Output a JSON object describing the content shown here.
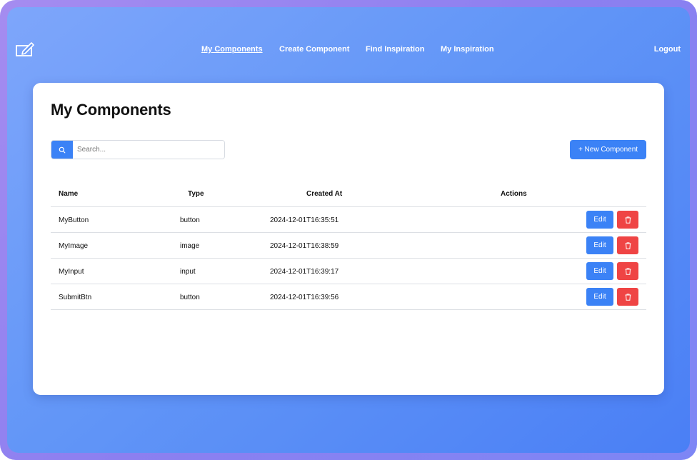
{
  "nav": {
    "links": [
      {
        "label": "My Components",
        "active": true
      },
      {
        "label": "Create Component",
        "active": false
      },
      {
        "label": "Find Inspiration",
        "active": false
      },
      {
        "label": "My Inspiration",
        "active": false
      }
    ],
    "logout": "Logout"
  },
  "page": {
    "title": "My Components",
    "search_placeholder": "Search...",
    "new_button": "+ New Component"
  },
  "table": {
    "headers": {
      "name": "Name",
      "type": "Type",
      "created": "Created At",
      "actions": "Actions"
    },
    "rows": [
      {
        "name": "MyButton",
        "type": "button",
        "created": "2024-12-01T16:35:51",
        "edit": "Edit"
      },
      {
        "name": "MyImage",
        "type": "image",
        "created": "2024-12-01T16:38:59",
        "edit": "Edit"
      },
      {
        "name": "MyInput",
        "type": "input",
        "created": "2024-12-01T16:39:17",
        "edit": "Edit"
      },
      {
        "name": "SubmitBtn",
        "type": "button",
        "created": "2024-12-01T16:39:56",
        "edit": "Edit"
      }
    ]
  },
  "icons": {
    "logo": "edit-square-icon",
    "search": "search-icon",
    "delete": "trash-icon"
  },
  "colors": {
    "primary": "#3b82f6",
    "danger": "#ef4444",
    "background_start": "#7ea6fb",
    "background_end": "#4a7ff5"
  }
}
